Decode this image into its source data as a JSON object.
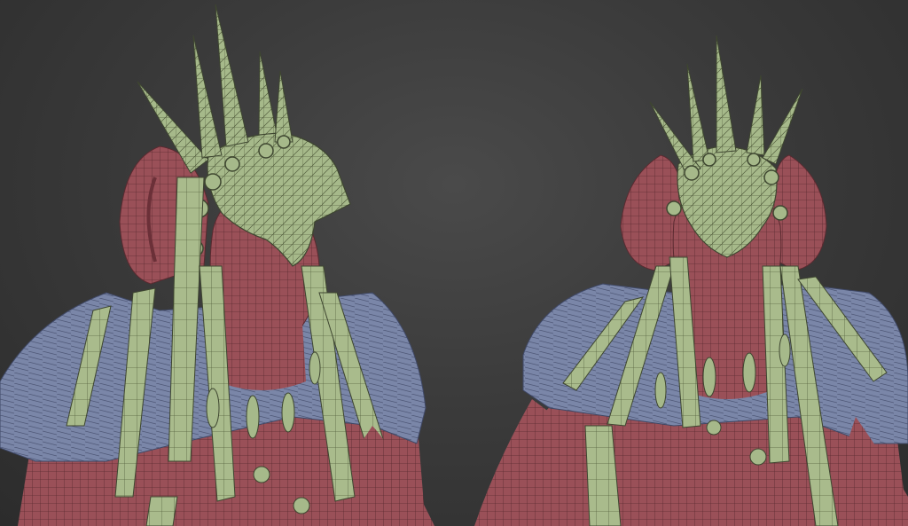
{
  "scene": {
    "description_visible_text": "",
    "colors": {
      "background": "#3b3b3b",
      "skin": "#9a5058",
      "skin_wire": "#5a2a30",
      "mask": "#a6b98a",
      "mask_wire": "#55603f",
      "feathers": "#7a86a8",
      "feathers_dark": "#4f5877",
      "wire": "#2a2a2a"
    },
    "models": [
      {
        "view": "left"
      },
      {
        "view": "right"
      }
    ]
  }
}
